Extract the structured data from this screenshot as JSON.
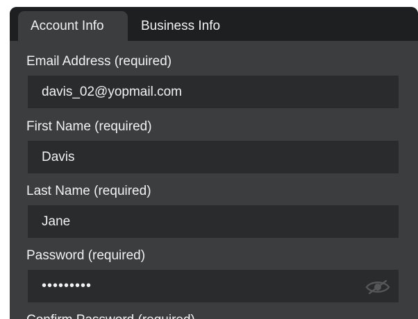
{
  "tabs": [
    {
      "label": "Account Info",
      "active": true
    },
    {
      "label": "Business Info",
      "active": false
    }
  ],
  "fields": {
    "email": {
      "label": "Email Address (required)",
      "value": "davis_02@yopmail.com"
    },
    "first_name": {
      "label": "First Name (required)",
      "value": "Davis"
    },
    "last_name": {
      "label": "Last Name (required)",
      "value": "Jane"
    },
    "password": {
      "label": "Password (required)",
      "value": "•••••••••"
    },
    "confirm_password": {
      "label": "Confirm Password (required)"
    }
  },
  "icons": {
    "password_toggle": "eye-icon"
  },
  "colors": {
    "panel_bg": "#3b3d3e",
    "tabbar_bg": "#1e1f20",
    "field_bg": "#2a2b2c",
    "text": "#f2f2f2"
  }
}
